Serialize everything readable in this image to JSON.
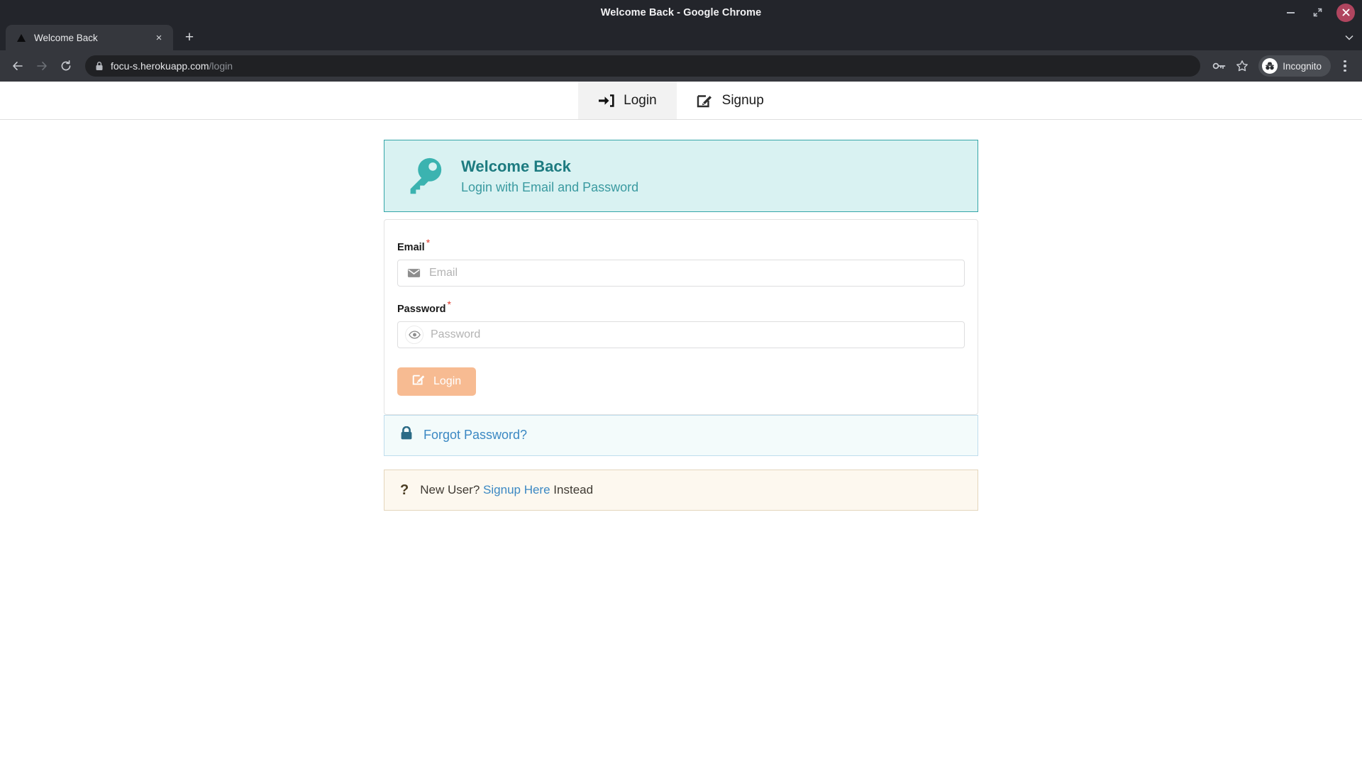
{
  "window": {
    "title": "Welcome Back - Google Chrome",
    "minimize_label": "Minimize",
    "maximize_label": "Restore",
    "close_label": "Close"
  },
  "browser": {
    "tab": {
      "title": "Welcome Back",
      "close_label": "×"
    },
    "new_tab_label": "+",
    "tab_list_label": "⌄",
    "back_label": "←",
    "forward_label": "→",
    "reload_label": "⟳",
    "omnibox": {
      "domain": "focu-s.herokuapp.com",
      "path": "/login"
    },
    "profile": {
      "label": "Incognito"
    }
  },
  "page": {
    "tabs": [
      {
        "label": "Login",
        "icon": "sign-in-icon",
        "active": true
      },
      {
        "label": "Signup",
        "icon": "edit-icon",
        "active": false
      }
    ],
    "welcome": {
      "icon": "key-icon",
      "title": "Welcome Back",
      "subtitle": "Login with Email and Password"
    },
    "form": {
      "email": {
        "label": "Email",
        "required_marker": "*",
        "placeholder": "Email",
        "value": "",
        "icon": "envelope-icon"
      },
      "password": {
        "label": "Password",
        "required_marker": "*",
        "placeholder": "Password",
        "value": "",
        "icon": "eye-icon"
      },
      "submit": {
        "label": "Login",
        "icon": "edit-icon"
      }
    },
    "forgot": {
      "icon": "lock-icon",
      "link_text": "Forgot Password?"
    },
    "newuser": {
      "icon": "question-mark-icon",
      "prefix": "New User?",
      "link_text": "Signup Here",
      "suffix": "Instead"
    }
  },
  "colors": {
    "teal": "#34a5a8",
    "teal_dark": "#1d7b80",
    "teal_bg": "#d9f2f2",
    "link_blue": "#3b88c3",
    "peach": "#f7bb92",
    "required_red": "#e0392b",
    "cream_bg": "#fdf8ef",
    "cream_border": "#e4d6bc",
    "info_bg": "#f3fbfb",
    "info_border": "#bfdded"
  }
}
